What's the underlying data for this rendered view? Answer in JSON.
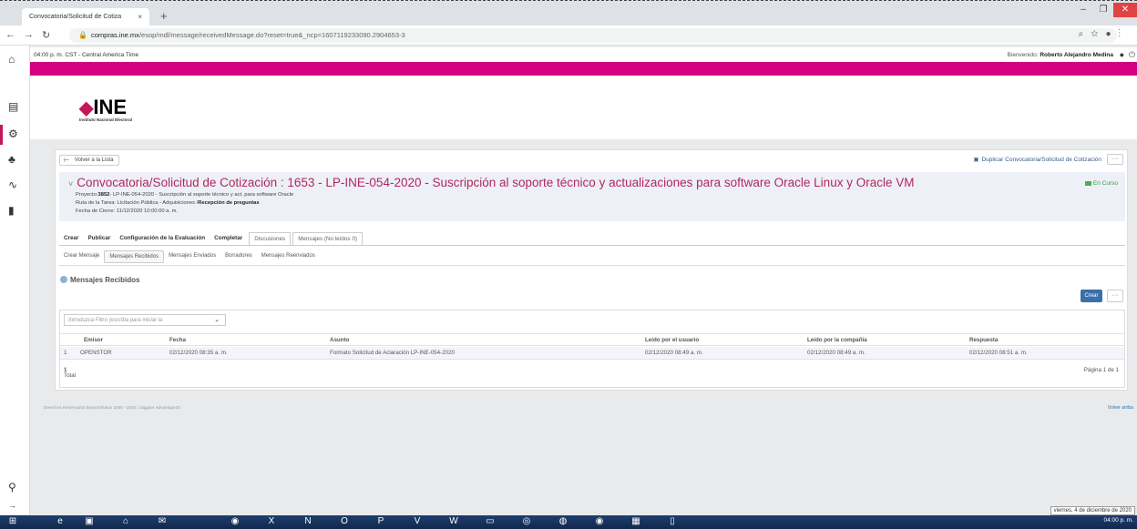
{
  "browser": {
    "tab_title": "Convocatoria/Solicitud de Cotiza",
    "tab_close": "×",
    "new_tab": "+",
    "url_host": "compras.ine.mx",
    "url_path": "/esop/mdl/message/receivedMessage.do?reset=true&_ncp=1607119233090.2904653-3"
  },
  "topbar": {
    "time": "04:00 p. m. CST - Central America Time",
    "welcome_prefix": "Bienvenido:",
    "user_name": "Roberto Alejandro Medina"
  },
  "logo": {
    "name": "INE",
    "subtitle": "Instituto Nacional Electoral"
  },
  "page": {
    "back_label": "Volver a la Lista",
    "duplicate_label": "Duplicar Convocatoria/Solicitud de Cotización",
    "more": "···",
    "title": "Convocatoria/Solicitud de Cotización : 1653 - LP-INE-054-2020 - Suscripción al soporte técnico y actualizaciones para software Oracle Linux y Oracle VM",
    "status": "En Curso",
    "project_label": "Proyecto:",
    "project_id": "3852",
    "project_text": "- LP-INE-054-2020 - Suscripción al soporte técnico y act. para software Oracle",
    "route_label": "Ruta de la Tarea:",
    "route_text": "Licitación Pública - Adquisiciones /",
    "route_bold": "Recepción de preguntas",
    "close_label": "Fecha de Cierre:",
    "close_date": "11/12/2020 10:00:00 a. m."
  },
  "tabs_main": [
    "Crear",
    "Publicar",
    "Configuración de la Evaluación",
    "Completar",
    "Discusiones",
    "Mensajes (No leídos 0)"
  ],
  "tabs_sub": [
    "Crear Mensaje",
    "Mensajes Recibidos",
    "Mensajes Enviados",
    "Borradores",
    "Mensajes Reenviados"
  ],
  "section": {
    "title": "Mensajes Recibidos",
    "create_label": "Crear"
  },
  "table": {
    "filter_placeholder": "Introduzca Filtro (escriba para iniciar la",
    "headers": [
      "Emisor",
      "Fecha",
      "Asunto",
      "Leído por el usuario",
      "Leído por la compañía",
      "Respuesta"
    ],
    "rows": [
      {
        "n": "1",
        "emisor": "OPENSTOR",
        "fecha": "02/12/2020 08:35 a. m.",
        "asunto": "Formato Solicitud de Aclaración LP-INE-054-2020",
        "leido_usuario": "02/12/2020 08:49 a. m.",
        "leido_compania": "02/12/2020 08:49 a. m.",
        "respuesta": "02/12/2020 08:51 a. m."
      }
    ],
    "total_label": "Total",
    "total_value": "1",
    "pagination": "Página 1 de 1"
  },
  "footer": {
    "copyright": "Derechos Reservados BravoSolution 2000 - 2020 / Jaggaer Advantage20",
    "back_to_top": "Volver arriba"
  },
  "os": {
    "date_tooltip": "viernes, 4 de diciembre de 2020",
    "clock": "04:00 p. m."
  }
}
